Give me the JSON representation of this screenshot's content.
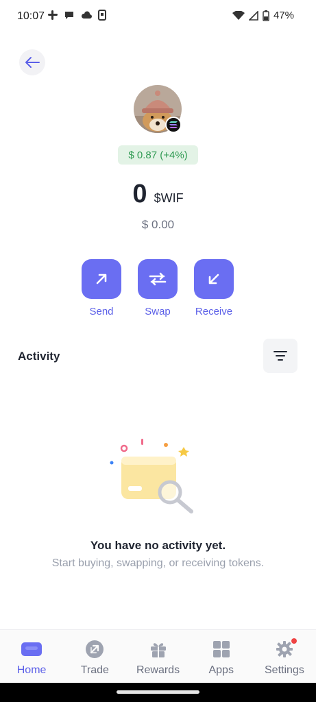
{
  "status_bar": {
    "time": "10:07",
    "battery": "47%"
  },
  "token": {
    "price_change": "$ 0.87 (+4%)",
    "balance_amount": "0",
    "symbol": "$WIF",
    "fiat_value": "$ 0.00"
  },
  "actions": [
    {
      "label": "Send",
      "icon": "arrow-up-right-icon"
    },
    {
      "label": "Swap",
      "icon": "swap-icon"
    },
    {
      "label": "Receive",
      "icon": "arrow-down-left-icon"
    }
  ],
  "activity": {
    "title": "Activity",
    "empty_title": "You have no activity yet.",
    "empty_subtitle": "Start buying, swapping, or receiving tokens."
  },
  "nav": [
    {
      "label": "Home",
      "icon": "home-wallet-icon",
      "active": true
    },
    {
      "label": "Trade",
      "icon": "trade-icon",
      "active": false
    },
    {
      "label": "Rewards",
      "icon": "gift-icon",
      "active": false
    },
    {
      "label": "Apps",
      "icon": "apps-grid-icon",
      "active": false
    },
    {
      "label": "Settings",
      "icon": "gear-icon",
      "active": false
    }
  ],
  "colors": {
    "accent": "#6a6ef2",
    "price_positive": "#2f9a52",
    "price_chip_bg": "#e3f3e6",
    "notification": "#ef4444"
  }
}
